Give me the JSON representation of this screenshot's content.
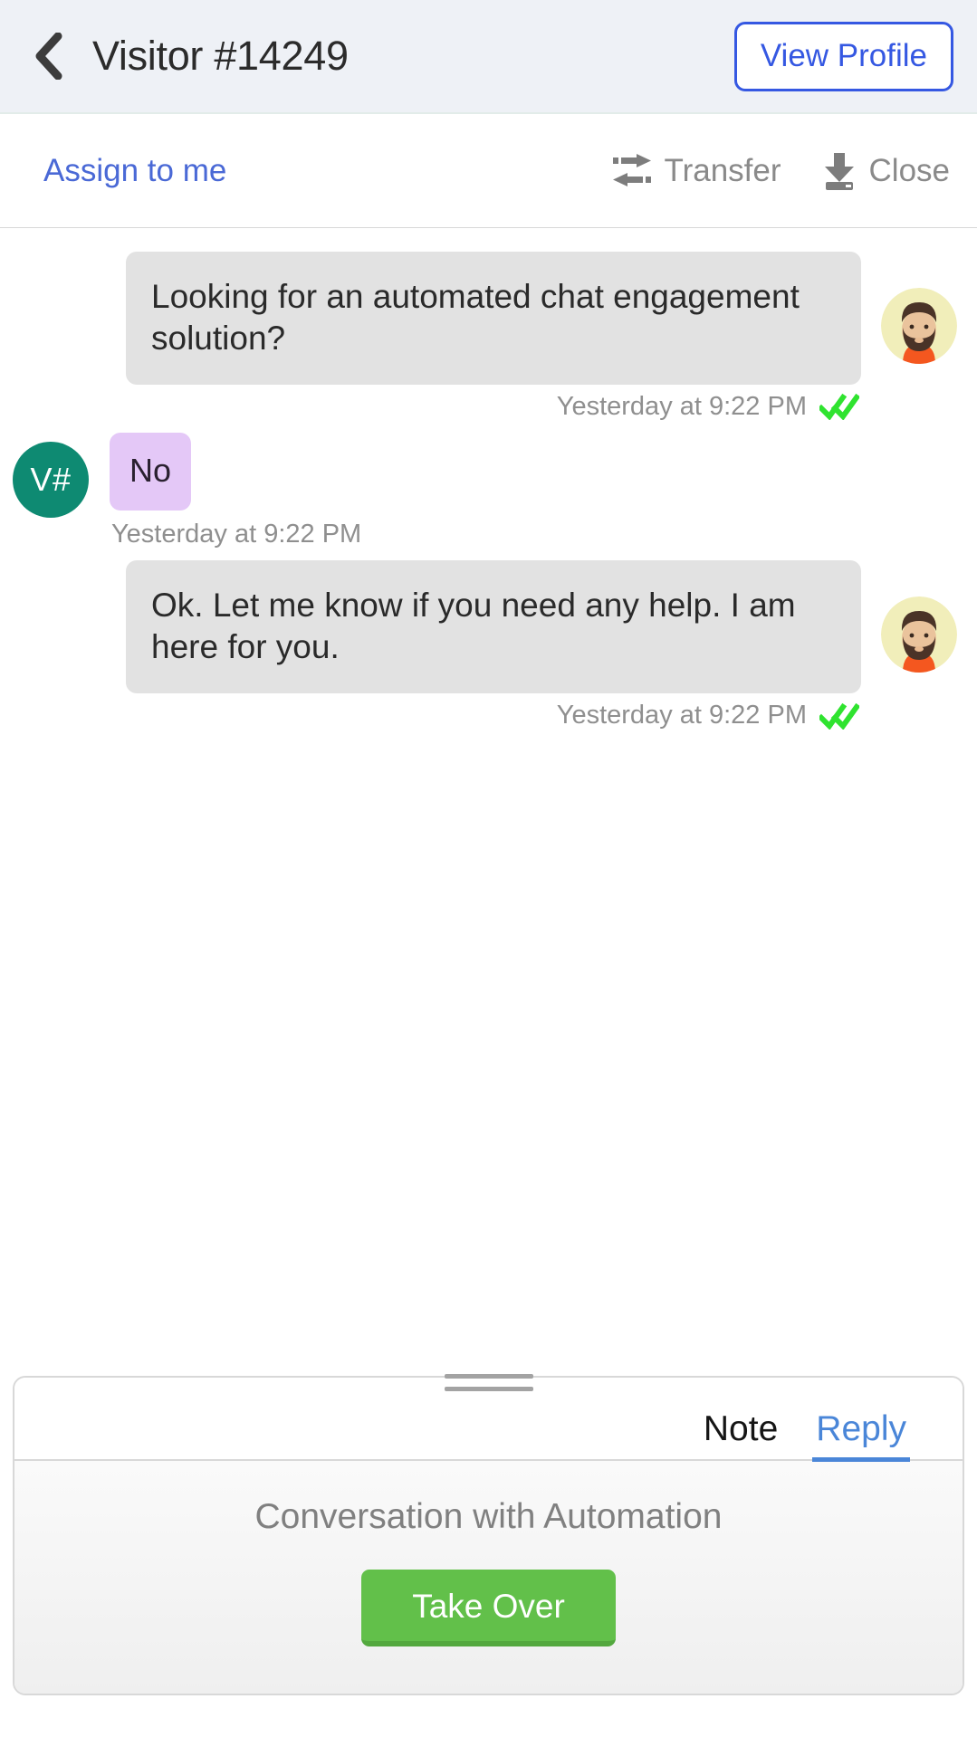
{
  "header": {
    "back_icon": "chevron-left-icon",
    "title": "Visitor #14249",
    "view_profile_label": "View Profile",
    "bg_color": "#eef1f6",
    "accent_color": "#3558e2"
  },
  "actionbar": {
    "assign_label": "Assign to me",
    "assign_color": "#4a69d6",
    "transfer_label": "Transfer",
    "transfer_icon": "transfer-arrows-icon",
    "close_label": "Close",
    "close_icon": "archive-download-icon",
    "text_color": "#8a8a8a"
  },
  "conversation": {
    "messages": [
      {
        "id": "msg-1",
        "sender": "agent",
        "text": "Looking for an automated chat engagement solution?",
        "timestamp": "Yesterday at 9:22 PM",
        "read_receipt": true,
        "receipt_icon": "double-check-icon",
        "bubble_color": "#e2e2e2",
        "avatar": "agent-photo-avatar"
      },
      {
        "id": "msg-2",
        "sender": "visitor",
        "text": "No",
        "timestamp": "Yesterday at 9:22 PM",
        "read_receipt": false,
        "bubble_color": "#e4c8f7",
        "avatar_initials": "V#",
        "avatar_color": "#0e8a72"
      },
      {
        "id": "msg-3",
        "sender": "agent",
        "text": "Ok. Let me know if you need any help. I am here for you.",
        "timestamp": "Yesterday at 9:22 PM",
        "read_receipt": true,
        "receipt_icon": "double-check-icon",
        "bubble_color": "#e2e2e2",
        "avatar": "agent-photo-avatar"
      }
    ],
    "receipt_color": "#2fe32f"
  },
  "composer": {
    "drag_handle": "resize-grip",
    "tabs": [
      {
        "id": "note",
        "label": "Note",
        "active": false
      },
      {
        "id": "reply",
        "label": "Reply",
        "active": true
      }
    ],
    "active_tab_color": "#4a86d8",
    "automation_notice": "Conversation with Automation",
    "take_over_label": "Take Over",
    "take_over_color": "#62c04a"
  }
}
